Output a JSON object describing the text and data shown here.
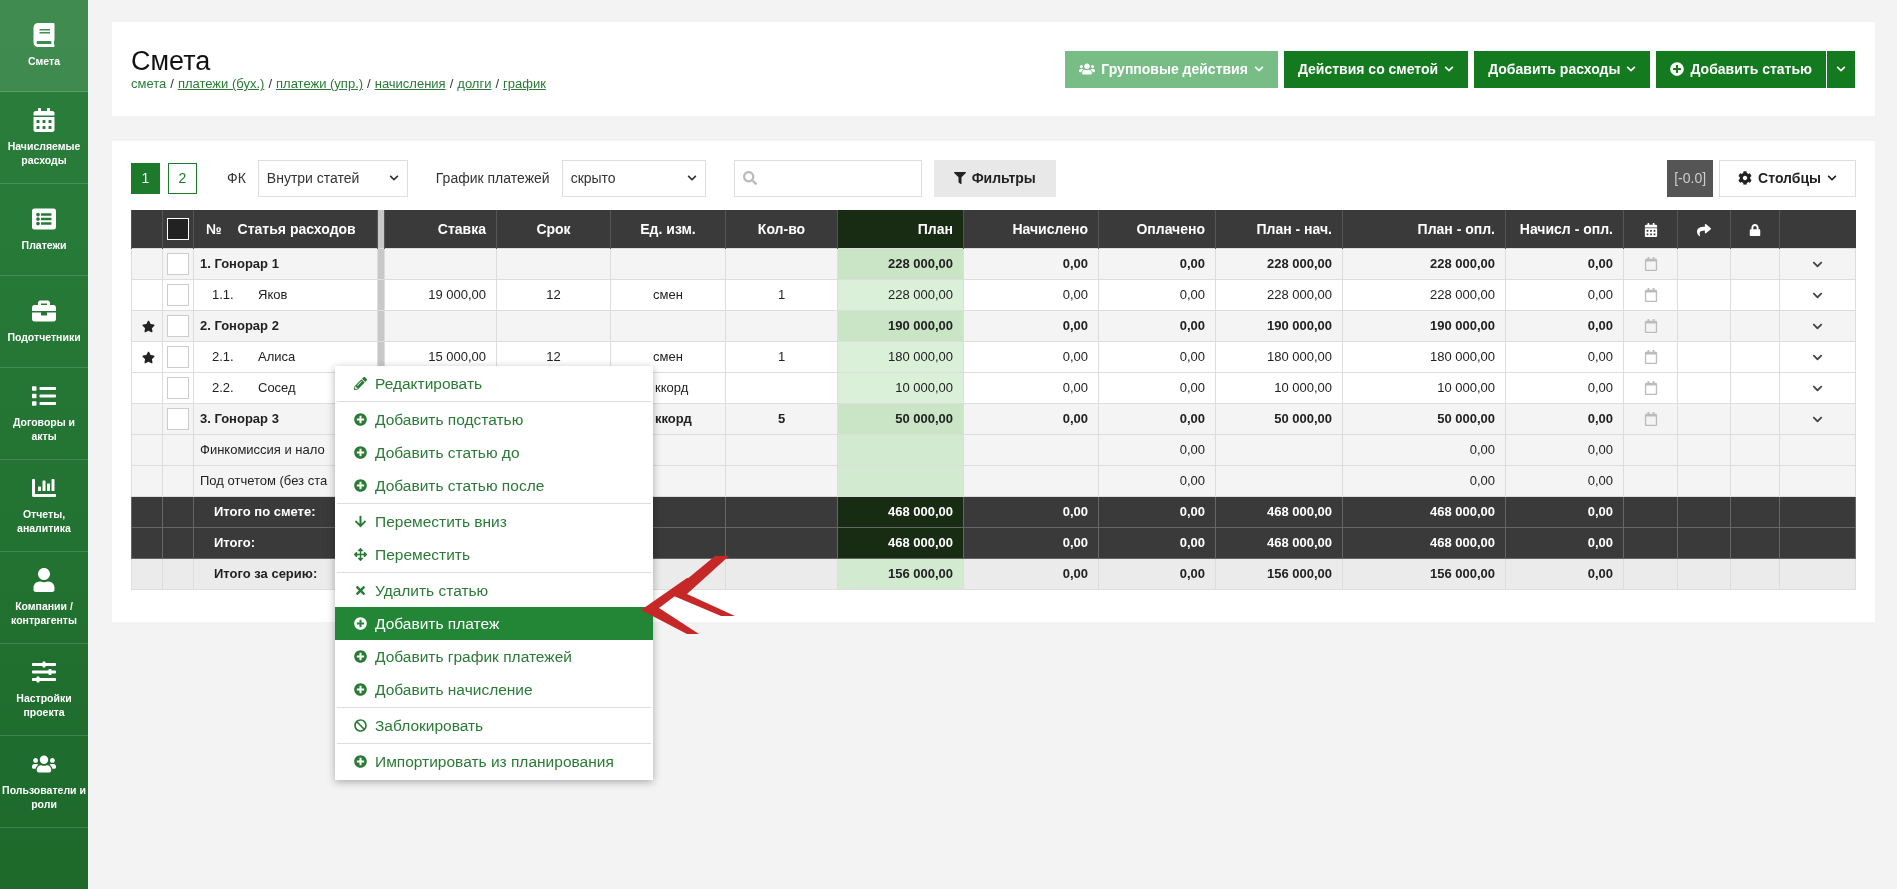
{
  "sidebar": {
    "items": [
      {
        "label": "Смета",
        "selected": true
      },
      {
        "label": "Начисляемые расходы",
        "selected": false
      },
      {
        "label": "Платежи",
        "selected": false
      },
      {
        "label": "Подотчетники",
        "selected": false
      },
      {
        "label": "Договоры и акты",
        "selected": false
      },
      {
        "label": "Отчеты, аналитика",
        "selected": false
      },
      {
        "label": "Компании / контрагенты",
        "selected": false
      },
      {
        "label": "Настройки проекта",
        "selected": false
      },
      {
        "label": "Пользователи и роли",
        "selected": false
      }
    ]
  },
  "header": {
    "title": "Смета",
    "separator": "/",
    "breadcrumbs": [
      {
        "label": "смета",
        "link": false
      },
      {
        "label": "платежи (бух.)",
        "link": true
      },
      {
        "label": "платежи (упр.)",
        "link": true
      },
      {
        "label": "начисления",
        "link": true
      },
      {
        "label": "долги",
        "link": true
      },
      {
        "label": "график",
        "link": true
      }
    ],
    "buttons": [
      {
        "label": "Групповые действия",
        "kind": "muted"
      },
      {
        "label": "Действия со сметой",
        "kind": "dropdown"
      },
      {
        "label": "Добавить расходы",
        "kind": "dropdown"
      },
      {
        "label": "Добавить статью",
        "kind": "split"
      }
    ]
  },
  "toolbar": {
    "pages": [
      {
        "label": "1",
        "selected": true
      },
      {
        "label": "2",
        "selected": false
      }
    ],
    "fk": {
      "label": "ФК",
      "value": "Внутри статей"
    },
    "schedule": {
      "label": "График платежей",
      "value": "скрыто"
    },
    "filters_button": "Фильтры",
    "badge": "[-0.0]",
    "columns_button": "Столбцы"
  },
  "table": {
    "select_all_checked": false,
    "columns": [
      "№",
      "Статья расходов",
      "Ставка",
      "Срок",
      "Ед. изм.",
      "Кол-во",
      "План",
      "Начислено",
      "Оплачено",
      "План - нач.",
      "План - опл.",
      "Начисл - опл."
    ],
    "rows": [
      {
        "kind": "group",
        "starred": false,
        "checked": false,
        "name": "1. Гонорар 1",
        "plan": "228 000,00",
        "accrued": "0,00",
        "paid": "0,00",
        "plan_acc": "228 000,00",
        "plan_paid": "228 000,00",
        "acc_paid": "0,00",
        "calendar": true,
        "expand": true
      },
      {
        "kind": "item",
        "starred": false,
        "checked": false,
        "number": "1.1.",
        "name": "Яков",
        "rate": "19 000,00",
        "term": "12",
        "unit": "смен",
        "qty": "1",
        "plan": "228 000,00",
        "accrued": "0,00",
        "paid": "0,00",
        "plan_acc": "228 000,00",
        "plan_paid": "228 000,00",
        "acc_paid": "0,00",
        "calendar": true,
        "expand": true
      },
      {
        "kind": "group",
        "starred": true,
        "checked": false,
        "name": "2. Гонорар 2",
        "plan": "190 000,00",
        "accrued": "0,00",
        "paid": "0,00",
        "plan_acc": "190 000,00",
        "plan_paid": "190 000,00",
        "acc_paid": "0,00",
        "calendar": true,
        "expand": true
      },
      {
        "kind": "item",
        "starred": true,
        "checked": false,
        "number": "2.1.",
        "name": "Алиса",
        "rate": "15 000,00",
        "term": "12",
        "unit": "смен",
        "qty": "1",
        "plan": "180 000,00",
        "accrued": "0,00",
        "paid": "0,00",
        "plan_acc": "180 000,00",
        "plan_paid": "180 000,00",
        "acc_paid": "0,00",
        "calendar": true,
        "expand": true
      },
      {
        "kind": "item",
        "starred": false,
        "checked": false,
        "number": "2.2.",
        "name": "Сосед",
        "unit": "ккорд",
        "unit_cut": true,
        "plan": "10 000,00",
        "accrued": "0,00",
        "paid": "0,00",
        "plan_acc": "10 000,00",
        "plan_paid": "10 000,00",
        "acc_paid": "0,00",
        "calendar": true,
        "expand": true
      },
      {
        "kind": "group",
        "starred": false,
        "checked": false,
        "name": "3. Гонорар 3",
        "unit": "ккорд",
        "unit_cut": true,
        "qty": "5",
        "plan": "50 000,00",
        "accrued": "0,00",
        "paid": "0,00",
        "plan_acc": "50 000,00",
        "plan_paid": "50 000,00",
        "acc_paid": "0,00",
        "calendar": true,
        "expand": true
      },
      {
        "kind": "summary",
        "name": "Финкомиссия и нало",
        "paid": "0,00",
        "plan_paid": "0,00",
        "acc_paid": "0,00"
      },
      {
        "kind": "summary",
        "name": "Под отчетом (без ста",
        "paid": "0,00",
        "plan_paid": "0,00",
        "acc_paid": "0,00"
      },
      {
        "kind": "total",
        "name": "Итого по смете:",
        "plan": "468 000,00",
        "accrued": "0,00",
        "paid": "0,00",
        "plan_acc": "468 000,00",
        "plan_paid": "468 000,00",
        "acc_paid": "0,00"
      },
      {
        "kind": "total",
        "name": "Итого:",
        "plan": "468 000,00",
        "accrued": "0,00",
        "paid": "0,00",
        "plan_acc": "468 000,00",
        "plan_paid": "468 000,00",
        "acc_paid": "0,00"
      },
      {
        "kind": "series",
        "name": "Итого за серию:",
        "plan": "156 000,00",
        "accrued": "0,00",
        "paid": "0,00",
        "plan_acc": "156 000,00",
        "plan_paid": "156 000,00",
        "acc_paid": "0,00"
      }
    ]
  },
  "context_menu": {
    "groups": [
      [
        {
          "label": "Редактировать",
          "kind": "edit",
          "selected": false
        }
      ],
      [
        {
          "label": "Добавить подстатью",
          "kind": "add",
          "selected": false
        },
        {
          "label": "Добавить статью до",
          "kind": "add",
          "selected": false
        },
        {
          "label": "Добавить статью после",
          "kind": "add",
          "selected": false
        }
      ],
      [
        {
          "label": "Переместить вниз",
          "kind": "down",
          "selected": false
        },
        {
          "label": "Переместить",
          "kind": "move",
          "selected": false
        }
      ],
      [
        {
          "label": "Удалить статью",
          "kind": "delete",
          "selected": false
        },
        {
          "label": "Добавить платеж",
          "kind": "add",
          "selected": true
        },
        {
          "label": "Добавить график платежей",
          "kind": "add",
          "selected": false
        },
        {
          "label": "Добавить начисление",
          "kind": "add",
          "selected": false
        }
      ],
      [
        {
          "label": "Заблокировать",
          "kind": "block",
          "selected": false
        }
      ],
      [
        {
          "label": "Импортировать из планирования",
          "kind": "add",
          "selected": false
        }
      ]
    ]
  }
}
